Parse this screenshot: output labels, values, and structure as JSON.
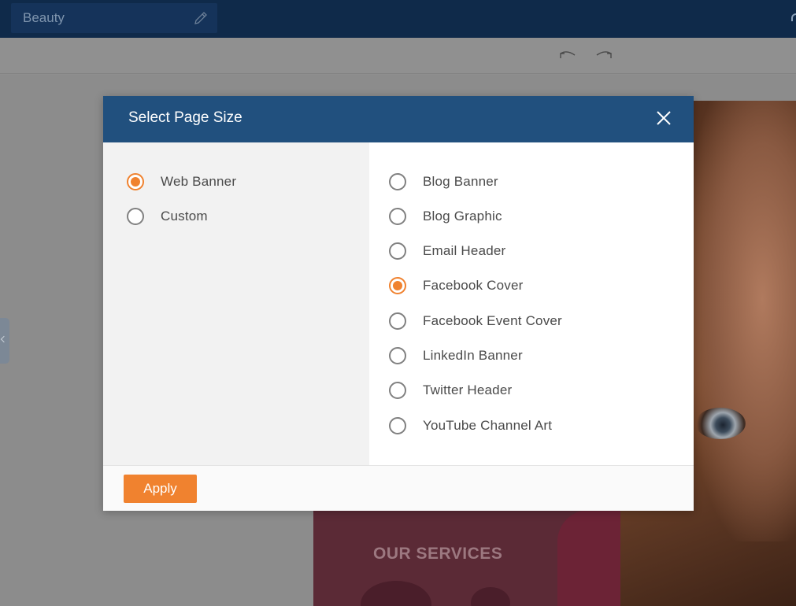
{
  "app": {
    "document_title": "Beauty"
  },
  "canvas": {
    "services_heading": "OUR SERVICES"
  },
  "icons": {
    "edit": "pencil-icon",
    "undo": "undo-icon",
    "redo": "redo-icon",
    "close": "close-icon"
  },
  "colors": {
    "accent": "#f0822f",
    "modal_header": "#21507e",
    "topbar": "#0f2a4a"
  },
  "modal": {
    "title": "Select Page Size",
    "categories": [
      {
        "label": "Web Banner",
        "selected": true
      },
      {
        "label": "Custom",
        "selected": false
      }
    ],
    "sizes": [
      {
        "label": "Blog Banner",
        "selected": false
      },
      {
        "label": "Blog Graphic",
        "selected": false
      },
      {
        "label": "Email Header",
        "selected": false
      },
      {
        "label": "Facebook Cover",
        "selected": true
      },
      {
        "label": "Facebook Event Cover",
        "selected": false
      },
      {
        "label": "LinkedIn Banner",
        "selected": false
      },
      {
        "label": "Twitter Header",
        "selected": false
      },
      {
        "label": "YouTube Channel Art",
        "selected": false
      }
    ],
    "apply_label": "Apply"
  }
}
